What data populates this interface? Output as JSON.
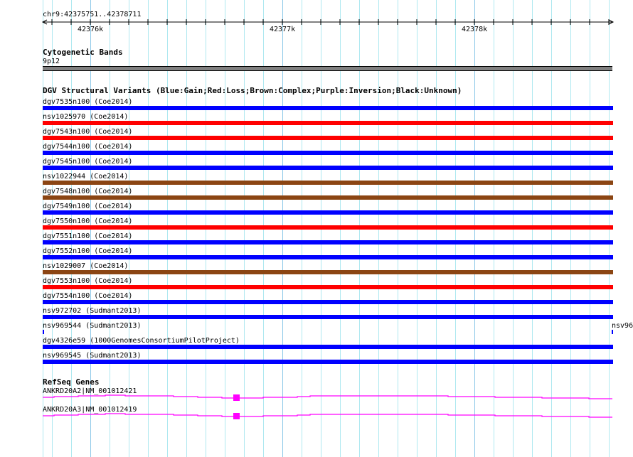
{
  "ruler": {
    "range": "chr9:42375751..42378711",
    "ticks": [
      "42376k",
      "42377k",
      "42378k"
    ]
  },
  "cyto": {
    "title": "Cytogenetic Bands",
    "band": "9p12",
    "color": "#808080"
  },
  "dgv": {
    "title": "DGV Structural Variants (Blue:Gain;Red:Loss;Brown:Complex;Purple:Inversion;Black:Unknown)",
    "colors": {
      "blue": "#0000ff",
      "red": "#ff0000",
      "brown": "#8b4513"
    },
    "rows": [
      {
        "label": "dgv7535n100 (Coe2014)",
        "color": "blue"
      },
      {
        "label": "nsv1025970 (Coe2014)",
        "color": "red"
      },
      {
        "label": "dgv7543n100 (Coe2014)",
        "color": "red"
      },
      {
        "label": "dgv7544n100 (Coe2014)",
        "color": "blue"
      },
      {
        "label": "dgv7545n100 (Coe2014)",
        "color": "blue"
      },
      {
        "label": "nsv1022944 (Coe2014)",
        "color": "brown"
      },
      {
        "label": "dgv7548n100 (Coe2014)",
        "color": "brown"
      },
      {
        "label": "dgv7549n100 (Coe2014)",
        "color": "blue"
      },
      {
        "label": "dgv7550n100 (Coe2014)",
        "color": "red"
      },
      {
        "label": "dgv7551n100 (Coe2014)",
        "color": "blue"
      },
      {
        "label": "dgv7552n100 (Coe2014)",
        "color": "blue"
      },
      {
        "label": "nsv1029007 (Coe2014)",
        "color": "brown"
      },
      {
        "label": "dgv7553n100 (Coe2014)",
        "color": "red"
      },
      {
        "label": "dgv7554n100 (Coe2014)",
        "color": "blue"
      },
      {
        "label": "nsv972702 (Sudmant2013)",
        "color": "blue"
      },
      {
        "label": "nsv969544 (Sudmant2013)",
        "color": "blue",
        "short": true,
        "right_label": "nsv96"
      },
      {
        "label": "dgv4326e59 (1000GenomesConsortiumPilotProject)",
        "color": "blue"
      },
      {
        "label": "nsv969545 (Sudmant2013)",
        "color": "blue"
      }
    ]
  },
  "refseq": {
    "title": "RefSeq Genes",
    "color": "#ff00ff",
    "genes": [
      {
        "label": "ANKRD20A2|NM_001012421"
      },
      {
        "label": "ANKRD20A3|NM_001012419"
      }
    ]
  }
}
